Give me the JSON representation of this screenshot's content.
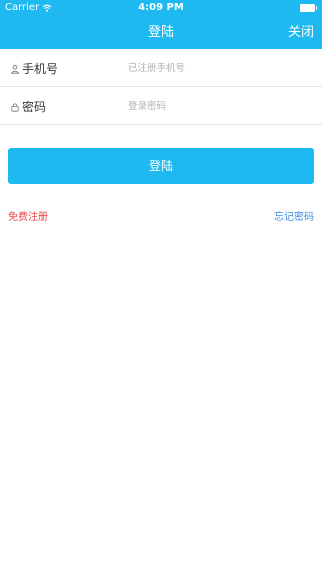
{
  "status_bar": {
    "carrier": "Carrier",
    "time": "4:09 PM",
    "icons": [
      "wifi-icon",
      "battery-icon"
    ]
  },
  "nav": {
    "title": "登陆",
    "close_label": "关闭"
  },
  "form": {
    "phone": {
      "label": "手机号",
      "icon": "user-icon",
      "placeholder": "已注册手机号",
      "value": ""
    },
    "password": {
      "label": "密码",
      "icon": "lock-icon",
      "placeholder": "登录密码",
      "value": ""
    }
  },
  "login_button_label": "登陆",
  "links": {
    "register": "免费注册",
    "forgot_password": "忘记密码"
  },
  "colors": {
    "primary": "#1fb9f2",
    "register_link": "#f04040",
    "forgot_link": "#3a8ee6",
    "divider": "#e2e2e2"
  }
}
